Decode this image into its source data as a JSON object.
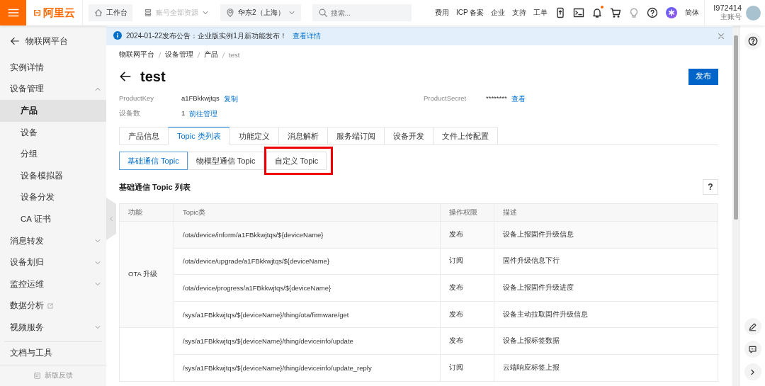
{
  "topbar": {
    "brand": "阿里云",
    "nav": [
      {
        "label": "工作台",
        "kind": "home",
        "disabled": false
      },
      {
        "label": "账号全部资源",
        "kind": "resources",
        "disabled": true
      },
      {
        "label": "华东2（上海）",
        "kind": "region",
        "disabled": false
      }
    ],
    "search": {
      "placeholder": "搜索..."
    },
    "links": [
      "费用",
      "ICP 备案",
      "企业",
      "支持",
      "工单"
    ],
    "notification_unread": true,
    "language": "简体",
    "user": {
      "name": "I972414",
      "role": "主账号"
    }
  },
  "notice": {
    "text": "2024-01-22发布公告：企业版实例1月新功能发布！",
    "link": "查看详情"
  },
  "sidebar": {
    "title": "物联网平台",
    "items": [
      {
        "label": "实例详情",
        "selected": false
      },
      {
        "label": "设备管理",
        "kind": "group",
        "expanded": true,
        "selected": false,
        "children": [
          {
            "label": "产品",
            "selected": true
          },
          {
            "label": "设备",
            "selected": false
          },
          {
            "label": "分组",
            "selected": false
          },
          {
            "label": "设备模拟器",
            "selected": false
          },
          {
            "label": "设备分发",
            "selected": false
          },
          {
            "label": "CA 证书",
            "selected": false
          }
        ]
      },
      {
        "label": "消息转发",
        "kind": "group",
        "expanded": false,
        "selected": false
      },
      {
        "label": "设备划归",
        "kind": "group",
        "expanded": false,
        "selected": false
      },
      {
        "label": "监控运维",
        "kind": "group",
        "expanded": false,
        "selected": false
      },
      {
        "label": "数据分析",
        "kind": "external",
        "selected": false
      },
      {
        "label": "视频服务",
        "kind": "group",
        "expanded": false,
        "selected": false
      }
    ],
    "bottom_item": "文档与工具",
    "feedback": "新版反馈"
  },
  "breadcrumb": [
    "物联网平台",
    "设备管理",
    "产品",
    "test"
  ],
  "page": {
    "title": "test",
    "publish_button": "发布",
    "fields": [
      {
        "label": "ProductKey",
        "value": "a1FBkkwjtqs",
        "action": "复制"
      },
      {
        "label": "ProductSecret",
        "value": "********",
        "action": "查看"
      },
      {
        "label": "设备数",
        "value": "1",
        "action": "前往管理"
      }
    ]
  },
  "tabs": [
    {
      "label": "产品信息",
      "selected": false
    },
    {
      "label": "Topic 类列表",
      "selected": true
    },
    {
      "label": "功能定义",
      "selected": false
    },
    {
      "label": "消息解析",
      "selected": false
    },
    {
      "label": "服务端订阅",
      "selected": false
    },
    {
      "label": "设备开发",
      "selected": false
    },
    {
      "label": "文件上传配置",
      "selected": false
    }
  ],
  "subtabs": [
    {
      "label": "基础通信 Topic",
      "selected": true,
      "highlighted": false
    },
    {
      "label": "物模型通信 Topic",
      "selected": false,
      "highlighted": false
    },
    {
      "label": "自定义 Topic",
      "selected": false,
      "highlighted": true
    }
  ],
  "table": {
    "title": "基础通信 Topic 列表",
    "help": "?",
    "columns": [
      "功能",
      "Topic类",
      "操作权限",
      "描述"
    ],
    "groups": [
      {
        "name": "OTA 升级",
        "rows": [
          [
            "/ota/device/inform/a1FBkkwjtqs/${deviceName}",
            "发布",
            "设备上报固件升级信息"
          ],
          [
            "/ota/device/upgrade/a1FBkkwjtqs/${deviceName}",
            "订阅",
            "固件升级信息下行"
          ],
          [
            "/ota/device/progress/a1FBkkwjtqs/${deviceName}",
            "发布",
            "设备上报固件升级进度"
          ],
          [
            "/sys/a1FBkkwjtqs/${deviceName}/thing/ota/firmware/get",
            "发布",
            "设备主动拉取固件升级信息"
          ]
        ]
      },
      {
        "rows": [
          [
            "/sys/a1FBkkwjtqs/${deviceName}/thing/deviceinfo/update",
            "发布",
            "设备上报标签数据"
          ],
          [
            "/sys/a1FBkkwjtqs/${deviceName}/thing/deviceinfo/update_reply",
            "订阅",
            "云端响应标签上报"
          ]
        ]
      }
    ]
  }
}
